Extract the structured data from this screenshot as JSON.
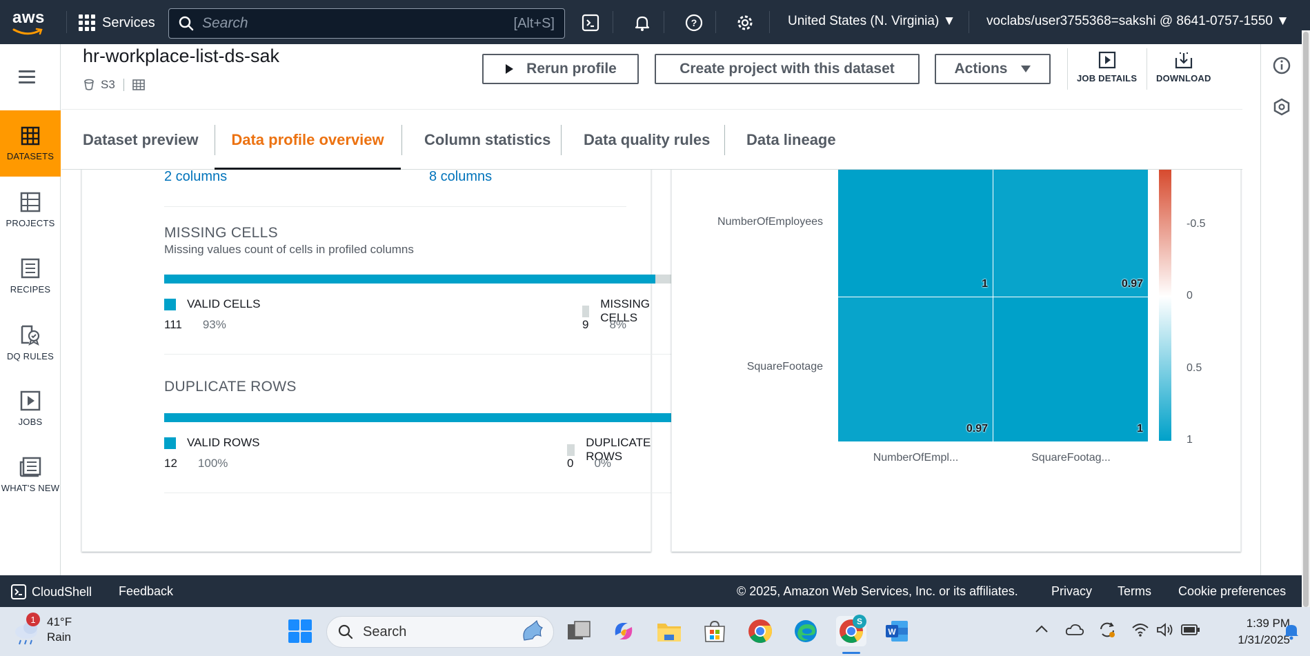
{
  "topnav": {
    "logo_text": "aws",
    "services_label": "Services",
    "search_placeholder": "Search",
    "search_hint": "[Alt+S]",
    "region": "United States (N. Virginia) ▼",
    "account": "voclabs/user3755368=sakshi @ 8641-0757-1550 ▼"
  },
  "left_rail": {
    "items": [
      {
        "label": "DATASETS",
        "icon": "datasets-icon",
        "active": true
      },
      {
        "label": "PROJECTS",
        "icon": "projects-icon"
      },
      {
        "label": "RECIPES",
        "icon": "recipes-icon"
      },
      {
        "label": "DQ RULES",
        "icon": "dq-rules-icon"
      },
      {
        "label": "JOBS",
        "icon": "jobs-icon"
      },
      {
        "label": "WHAT'S NEW",
        "icon": "whats-new-icon"
      }
    ]
  },
  "header": {
    "title": "hr-workplace-list-ds-sak",
    "source": "S3",
    "rerun_label": "Rerun profile",
    "create_project_label": "Create project with this dataset",
    "actions_label": "Actions",
    "job_details_label": "JOB DETAILS",
    "download_label": "DOWNLOAD"
  },
  "tabs": [
    {
      "label": "Dataset preview"
    },
    {
      "label": "Data profile overview",
      "active": true
    },
    {
      "label": "Column statistics"
    },
    {
      "label": "Data quality rules"
    },
    {
      "label": "Data lineage"
    }
  ],
  "summary": {
    "left_link": "2 columns",
    "right_link": "8 columns",
    "missing_cells": {
      "title": "MISSING CELLS",
      "description": "Missing values count of cells in profiled columns",
      "valid_label": "VALID CELLS",
      "valid_count": "111",
      "valid_pct": "93%",
      "valid_fraction": 0.93,
      "missing_label": "MISSING CELLS",
      "missing_count": "9",
      "missing_pct": "8%"
    },
    "duplicate_rows": {
      "title": "DUPLICATE ROWS",
      "valid_label": "VALID ROWS",
      "valid_count": "12",
      "valid_pct": "100%",
      "valid_fraction": 1.0,
      "dup_label": "DUPLICATE ROWS",
      "dup_count": "0",
      "dup_pct": "0%"
    }
  },
  "chart_data": {
    "type": "heatmap",
    "rows": [
      "NumberOfEmployees",
      "SquareFootage"
    ],
    "columns": [
      "NumberOfEmpl...",
      "SquareFootag..."
    ],
    "values": [
      [
        1,
        0.97
      ],
      [
        0.97,
        1
      ]
    ],
    "value_labels": [
      [
        "1",
        "0.97"
      ],
      [
        "0.97",
        "1"
      ]
    ],
    "colorbar_ticks": [
      "-0.5",
      "0",
      "0.5",
      "1"
    ],
    "colorbar_range": [
      -1,
      1
    ],
    "colors": {
      "negative": "#d13212",
      "zero": "#ffffff",
      "positive": "#00a1c9"
    }
  },
  "footer": {
    "cloudshell": "CloudShell",
    "feedback": "Feedback",
    "copyright": "© 2025, Amazon Web Services, Inc. or its affiliates.",
    "privacy": "Privacy",
    "terms": "Terms",
    "cookies": "Cookie preferences"
  },
  "taskbar": {
    "weather_temp": "41°F",
    "weather_desc": "Rain",
    "weather_badge": "1",
    "search_label": "Search",
    "time": "1:39 PM",
    "date": "1/31/2025",
    "chrome_profile_badge": "S"
  }
}
